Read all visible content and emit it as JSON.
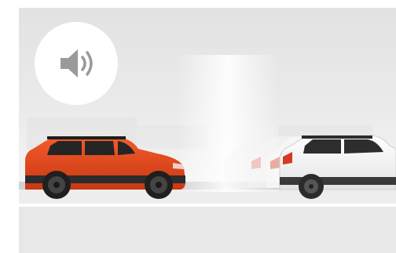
{
  "scene": {
    "description_icon": "speaker-sound-icon",
    "colors": {
      "lead_car": "#e8461c",
      "following_car": "#f7f7f7",
      "background": "#e6e6e6",
      "road": "#d2d2d2",
      "icon": "#9a9a9a"
    }
  }
}
